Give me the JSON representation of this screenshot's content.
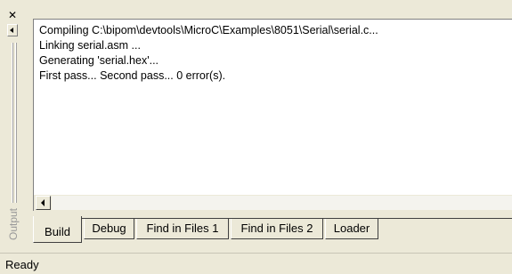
{
  "output_pane": {
    "side_label": "Output",
    "log_lines": [
      "Compiling C:\\bipom\\devtools\\MicroC\\Examples\\8051\\Serial\\serial.c...",
      "Linking serial.asm ...",
      "Generating 'serial.hex'...",
      "First pass... Second pass... 0 error(s)."
    ],
    "tabs": [
      {
        "label": "Build",
        "active": true
      },
      {
        "label": "Debug",
        "active": false
      },
      {
        "label": "Find in Files 1",
        "active": false
      },
      {
        "label": "Find in Files 2",
        "active": false
      },
      {
        "label": "Loader",
        "active": false
      }
    ],
    "icons": {
      "close": "close-icon",
      "restore": "restore-icon",
      "scroll_left": "scroll-left-arrow-icon"
    }
  },
  "statusbar": {
    "text": "Ready"
  }
}
